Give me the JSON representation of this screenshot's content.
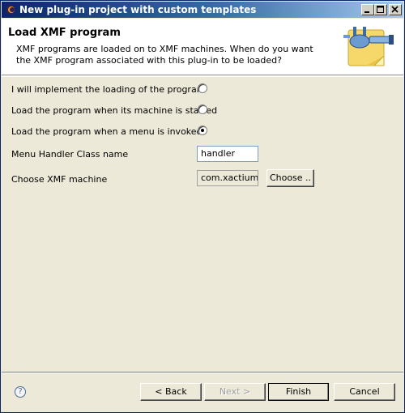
{
  "window": {
    "title": "New plug-in project with custom templates"
  },
  "header": {
    "title": "Load XMF program",
    "description": "XMF programs are loaded on to XMF machines. When do you want the XMF program associated with this plug-in to be loaded?"
  },
  "form": {
    "options": [
      {
        "label": "I will implement the loading of the program",
        "selected": false
      },
      {
        "label": "Load the program when its machine is started",
        "selected": false
      },
      {
        "label": "Load the program when a menu is invoked",
        "selected": true
      }
    ],
    "menu_handler": {
      "label": "Menu Handler Class name",
      "value": "handler"
    },
    "xmf_machine": {
      "label": "Choose XMF machine",
      "value": "com.xactium.",
      "button_label": "Choose .."
    }
  },
  "footer": {
    "back_label": "< Back",
    "next_label": "Next >",
    "finish_label": "Finish",
    "cancel_label": "Cancel"
  },
  "icons": {
    "help": "help-icon",
    "app": "eclipse-icon",
    "banner": "plugin-banner-icon"
  }
}
